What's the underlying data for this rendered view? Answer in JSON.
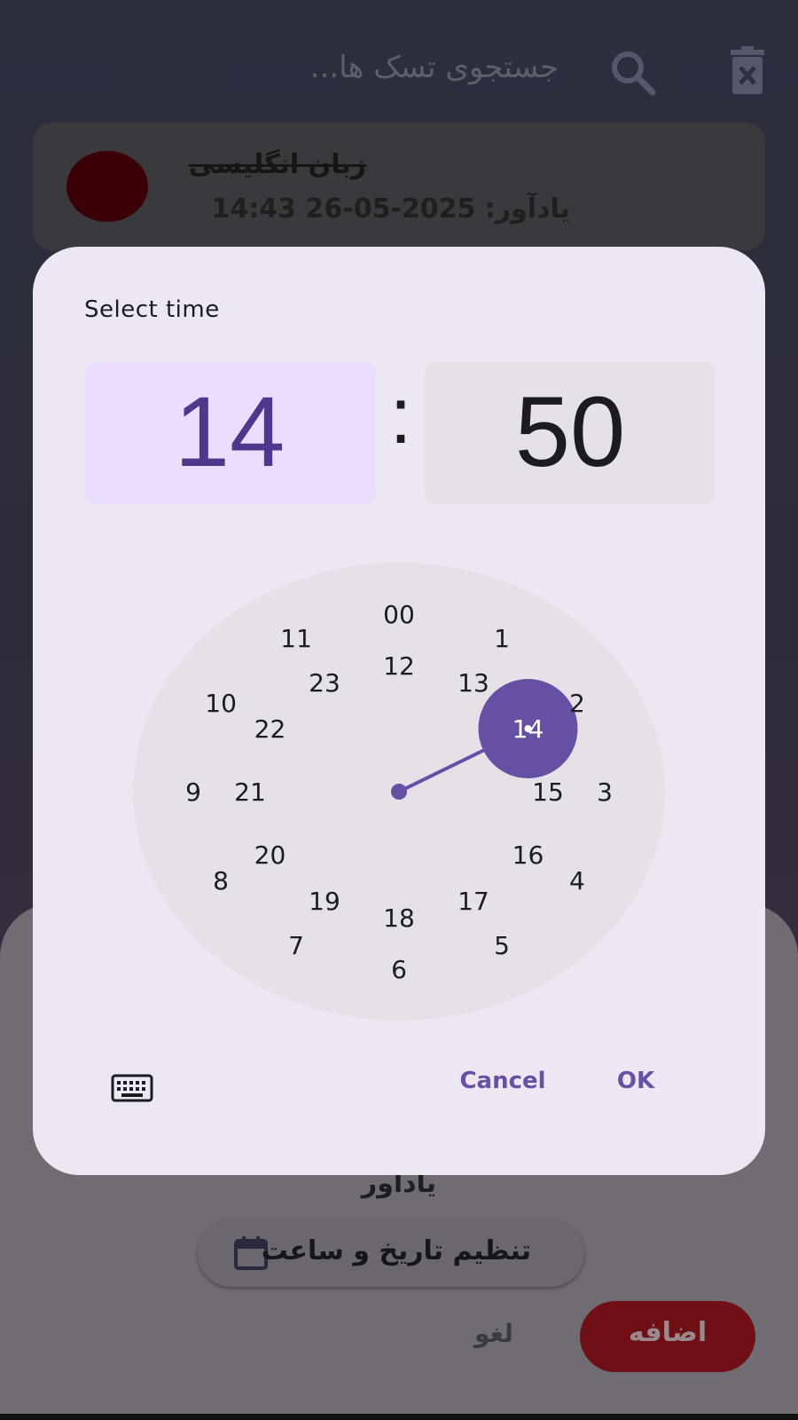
{
  "app": {
    "search_placeholder": "جستجوی تسک ها...",
    "task": {
      "title": "زبان انگلیسی",
      "reminder": "یادآور: 2025-05-26 14:43"
    },
    "sheet": {
      "reminder_label": "یادآور",
      "set_datetime_label": "تنظیم تاریخ و ساعت",
      "cancel_label": "لغو",
      "add_label": "اضافه"
    }
  },
  "dialog": {
    "title": "Select time",
    "hour": "14",
    "separator": ":",
    "minute": "50",
    "cancel_label": "Cancel",
    "ok_label": "OK",
    "selected_hour": 14,
    "outer_numbers": [
      "00",
      "1",
      "2",
      "3",
      "4",
      "5",
      "6",
      "7",
      "8",
      "9",
      "10",
      "11"
    ],
    "inner_numbers": [
      "12",
      "13",
      "14",
      "15",
      "16",
      "17",
      "18",
      "19",
      "20",
      "21",
      "22",
      "23"
    ]
  },
  "colors": {
    "accent": "#6750a4",
    "hour_box": "#eaddff",
    "clock_face": "#e6e0e9",
    "add_button": "#6e1016"
  },
  "icons": [
    "search-icon",
    "trash-icon",
    "calendar-icon",
    "keyboard-icon"
  ]
}
